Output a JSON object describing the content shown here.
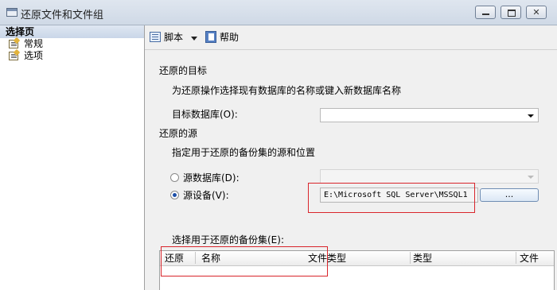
{
  "window": {
    "title": "还原文件和文件组"
  },
  "sidebar": {
    "header": "选择页",
    "items": [
      {
        "label": "常规"
      },
      {
        "label": "选项"
      }
    ]
  },
  "toolbar": {
    "script_label": "脚本",
    "help_label": "帮助"
  },
  "restore_target": {
    "section_title": "还原的目标",
    "description": "为还原操作选择现有数据库的名称或键入新数据库名称",
    "target_db_label": "目标数据库(O):",
    "target_db_value": ""
  },
  "restore_source": {
    "section_title": "还原的源",
    "description": "指定用于还原的备份集的源和位置",
    "source_db_label": "源数据库(D):",
    "source_device_label": "源设备(V):",
    "source_device_value": "E:\\Microsoft SQL Server\\MSSQL1",
    "browse_label": "...",
    "selected_option": "源设备(V):"
  },
  "backup_sets": {
    "label": "选择用于还原的备份集(E):",
    "columns": [
      "还原",
      "名称",
      "文件类型",
      "类型",
      "文件"
    ]
  }
}
